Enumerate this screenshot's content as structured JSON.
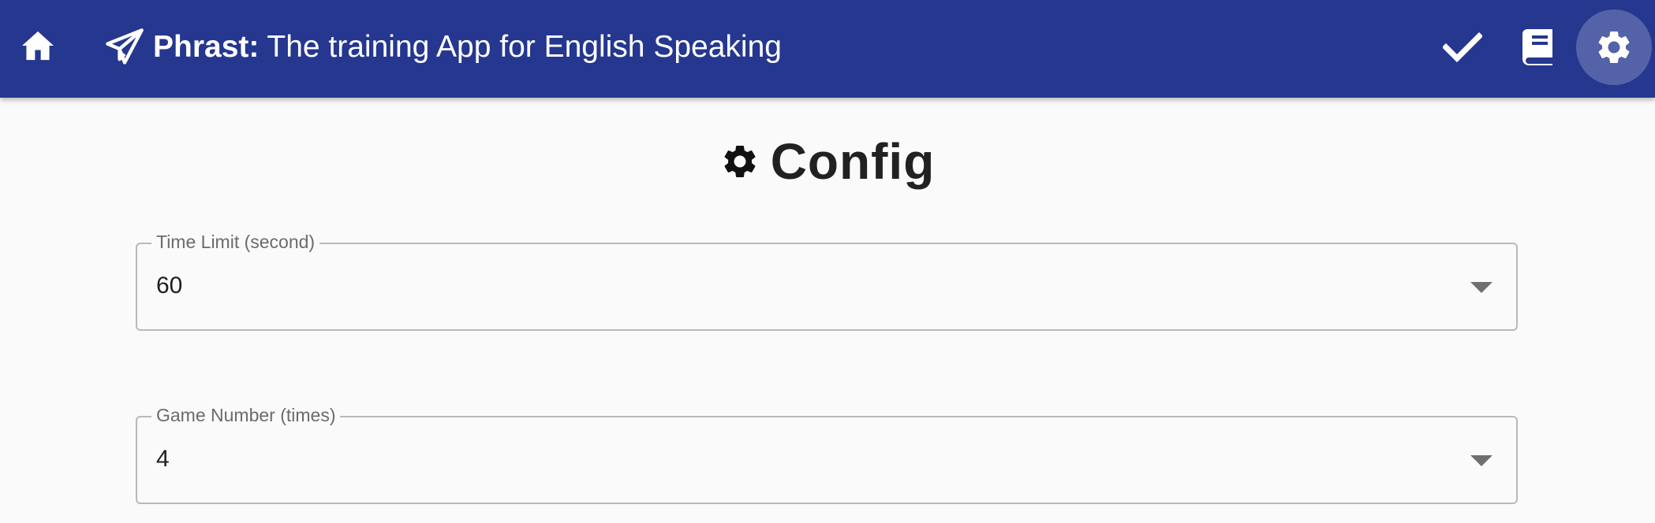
{
  "header": {
    "app_name": "Phrast:",
    "tagline": "The training App for English Speaking",
    "icons": {
      "home": "home-icon",
      "brand": "paper-plane-icon",
      "check": "check-icon",
      "book": "book-icon",
      "settings": "gear-icon"
    },
    "bar_color": "#25378f"
  },
  "page": {
    "title": "Config",
    "title_icon": "gear-icon"
  },
  "fields": {
    "time_limit": {
      "label": "Time Limit (second)",
      "value": "60"
    },
    "game_number": {
      "label": "Game Number (times)",
      "value": "4"
    }
  }
}
